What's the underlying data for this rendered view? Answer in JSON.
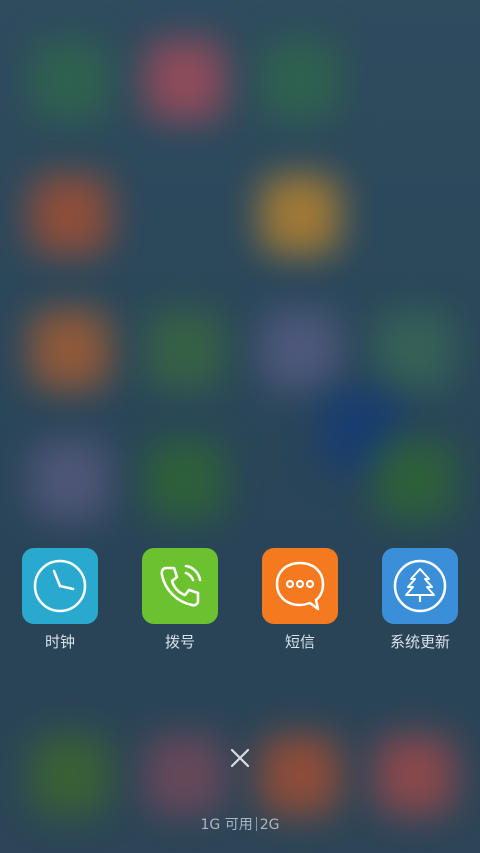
{
  "apps": [
    {
      "label": "时钟",
      "icon": "clock-icon",
      "color": "#2aa9cf"
    },
    {
      "label": "拨号",
      "icon": "phone-icon",
      "color": "#6bc22e"
    },
    {
      "label": "短信",
      "icon": "message-icon",
      "color": "#f5791f"
    },
    {
      "label": "系统更新",
      "icon": "tree-update-icon",
      "color": "#3b8fd8"
    }
  ],
  "close": {
    "icon": "close-icon"
  },
  "memory": {
    "available": "1G 可用",
    "total": "2G"
  }
}
